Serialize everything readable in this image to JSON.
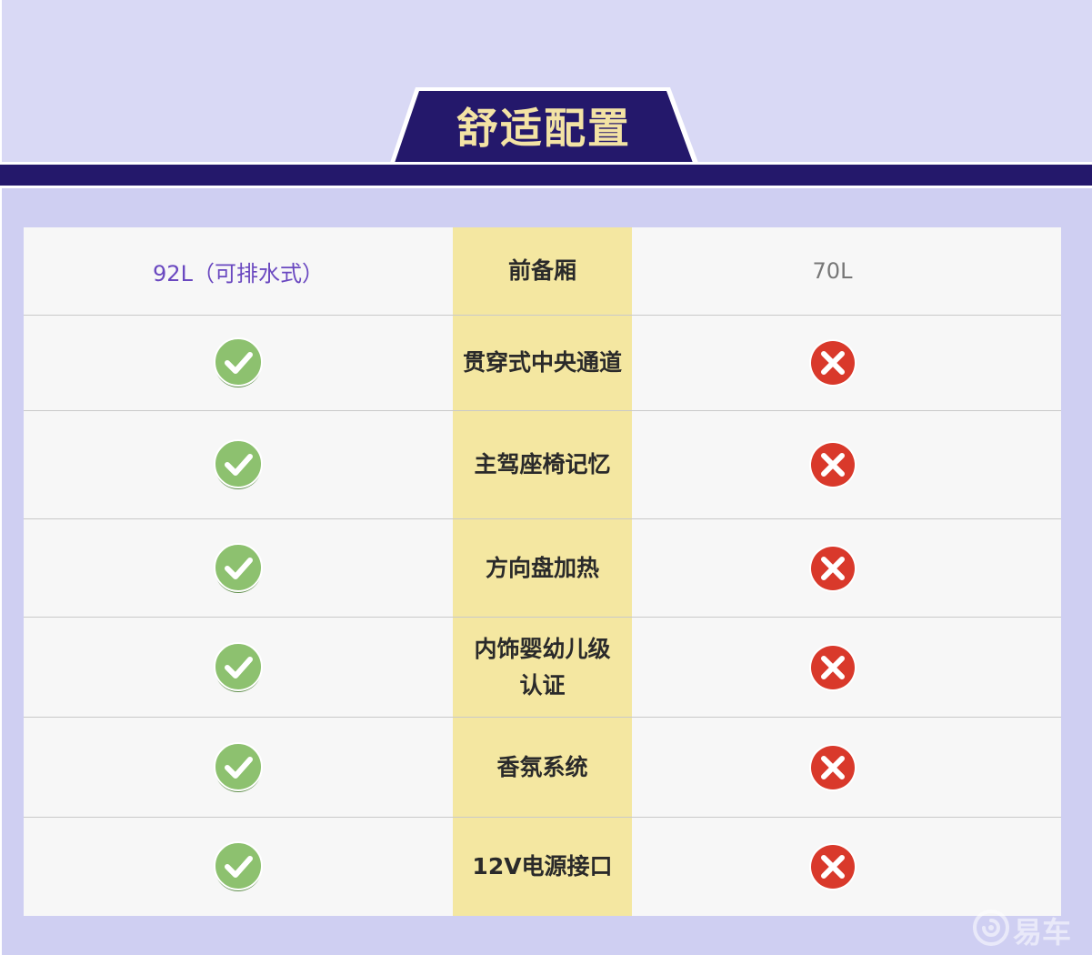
{
  "header": {
    "title": "舒适配置"
  },
  "colors": {
    "navy": "#24186b",
    "title_text": "#f3e3a4",
    "middle_column": "#f4e7a1",
    "left_value": "#6a48c0",
    "check_green": "#8dc16f",
    "cross_red": "#d9392b"
  },
  "table": {
    "rows": [
      {
        "left": "92L（可排水式）",
        "feature": "前备厢",
        "right": "70L"
      },
      {
        "left_icon": "check-icon",
        "feature": "贯穿式中央通道",
        "right_icon": "cross-icon"
      },
      {
        "left_icon": "check-icon",
        "feature": "主驾座椅记忆",
        "right_icon": "cross-icon"
      },
      {
        "left_icon": "check-icon",
        "feature": "方向盘加热",
        "right_icon": "cross-icon"
      },
      {
        "left_icon": "check-icon",
        "feature_line1": "内饰婴幼儿级",
        "feature_line2": "认证",
        "right_icon": "cross-icon"
      },
      {
        "left_icon": "check-icon",
        "feature": "香氛系统",
        "right_icon": "cross-icon"
      },
      {
        "left_icon": "check-icon",
        "feature": "12V电源接口",
        "right_icon": "cross-icon"
      }
    ]
  },
  "watermark": {
    "text": "易车"
  }
}
